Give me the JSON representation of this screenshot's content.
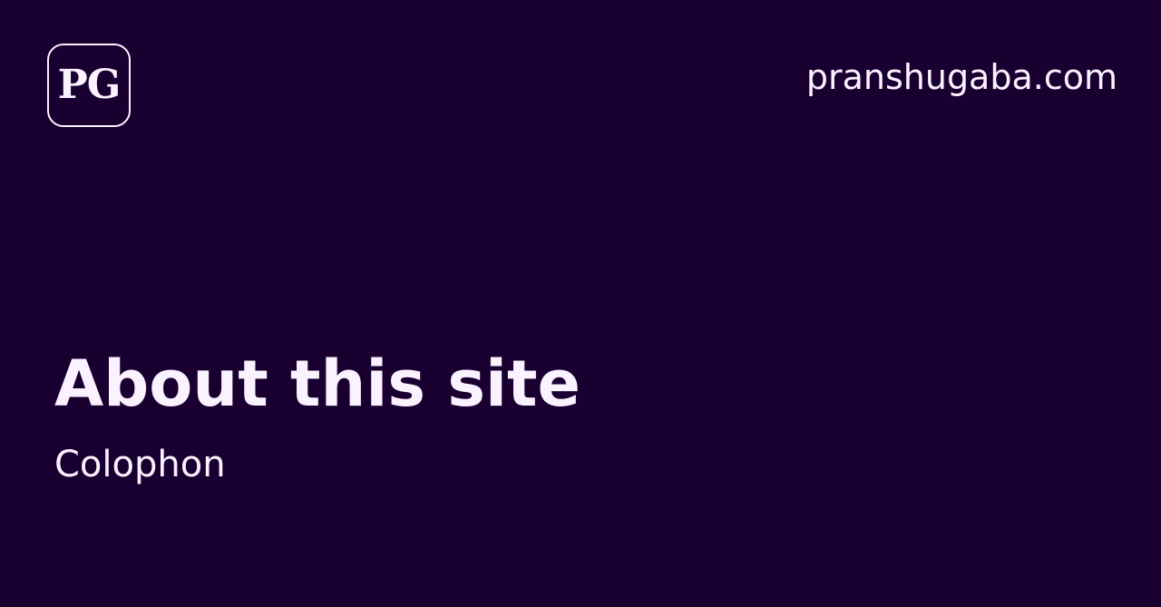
{
  "logo": {
    "text": "PG"
  },
  "header": {
    "domain": "pranshugaba.com"
  },
  "main": {
    "title": "About this site",
    "subtitle": "Colophon"
  },
  "colors": {
    "background": "#1a0030",
    "foreground": "#faf2ff"
  }
}
